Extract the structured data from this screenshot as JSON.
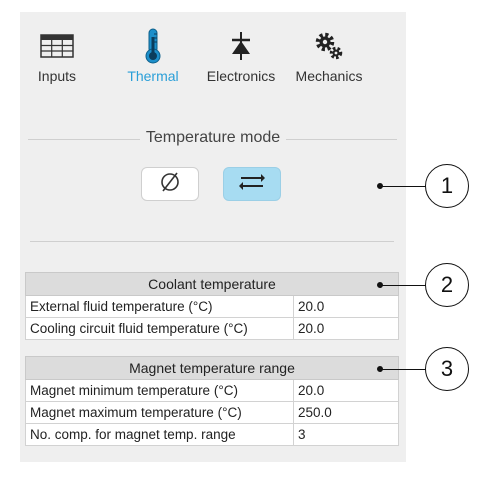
{
  "tabs": [
    {
      "label": "Inputs",
      "icon": "table-icon",
      "active": false
    },
    {
      "label": "Thermal",
      "icon": "thermometer-icon",
      "active": true
    },
    {
      "label": "Electronics",
      "icon": "diode-icon",
      "active": false
    },
    {
      "label": "Mechanics",
      "icon": "gears-icon",
      "active": false
    }
  ],
  "temperature_mode": {
    "title": "Temperature mode",
    "options": [
      {
        "icon": "empty-set-icon",
        "selected": false
      },
      {
        "icon": "exchange-arrows-icon",
        "selected": true
      }
    ]
  },
  "coolant": {
    "header": "Coolant temperature",
    "rows": [
      {
        "name": "External fluid temperature (°C)",
        "value": "20.0"
      },
      {
        "name": "Cooling circuit fluid temperature (°C)",
        "value": "20.0"
      }
    ]
  },
  "magnet": {
    "header": "Magnet temperature range",
    "rows": [
      {
        "name": "Magnet minimum temperature (°C)",
        "value": "20.0"
      },
      {
        "name": "Magnet maximum temperature (°C)",
        "value": "250.0"
      },
      {
        "name": "No. comp. for magnet temp. range",
        "value": "3"
      }
    ]
  },
  "callouts": [
    "1",
    "2",
    "3"
  ],
  "colors": {
    "active_tab": "#2a9fd8",
    "selected_mode": "#a7dcf2"
  }
}
